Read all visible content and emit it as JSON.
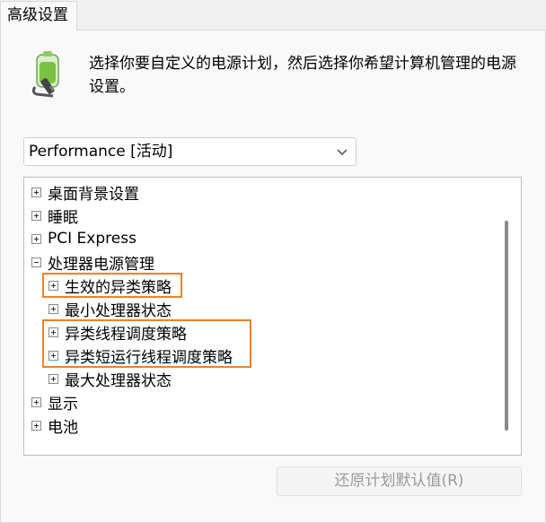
{
  "tabs": [
    {
      "label": "高级设置"
    }
  ],
  "header": {
    "icon": "battery-plug-icon",
    "description": "选择你要自定义的电源计划，然后选择你希望计算机管理的电源设置。"
  },
  "plan_select": {
    "value": "Performance [活动]"
  },
  "tree": {
    "items": [
      {
        "label": "桌面背景设置",
        "expanded": false
      },
      {
        "label": "睡眠",
        "expanded": false
      },
      {
        "label": "PCI Express",
        "expanded": false
      },
      {
        "label": "处理器电源管理",
        "expanded": true
      },
      {
        "label": "生效的异类策略",
        "expanded": false
      },
      {
        "label": "最小处理器状态",
        "expanded": false
      },
      {
        "label": "异类线程调度策略",
        "expanded": false
      },
      {
        "label": "异类短运行线程调度策略",
        "expanded": false
      },
      {
        "label": "最大处理器状态",
        "expanded": false
      },
      {
        "label": "显示",
        "expanded": false
      },
      {
        "label": "电池",
        "expanded": false
      }
    ]
  },
  "buttons": {
    "restore_defaults": "还原计划默认值(R)"
  },
  "colors": {
    "highlight": "#e8832a",
    "window_bg": "#f9f9f9"
  }
}
